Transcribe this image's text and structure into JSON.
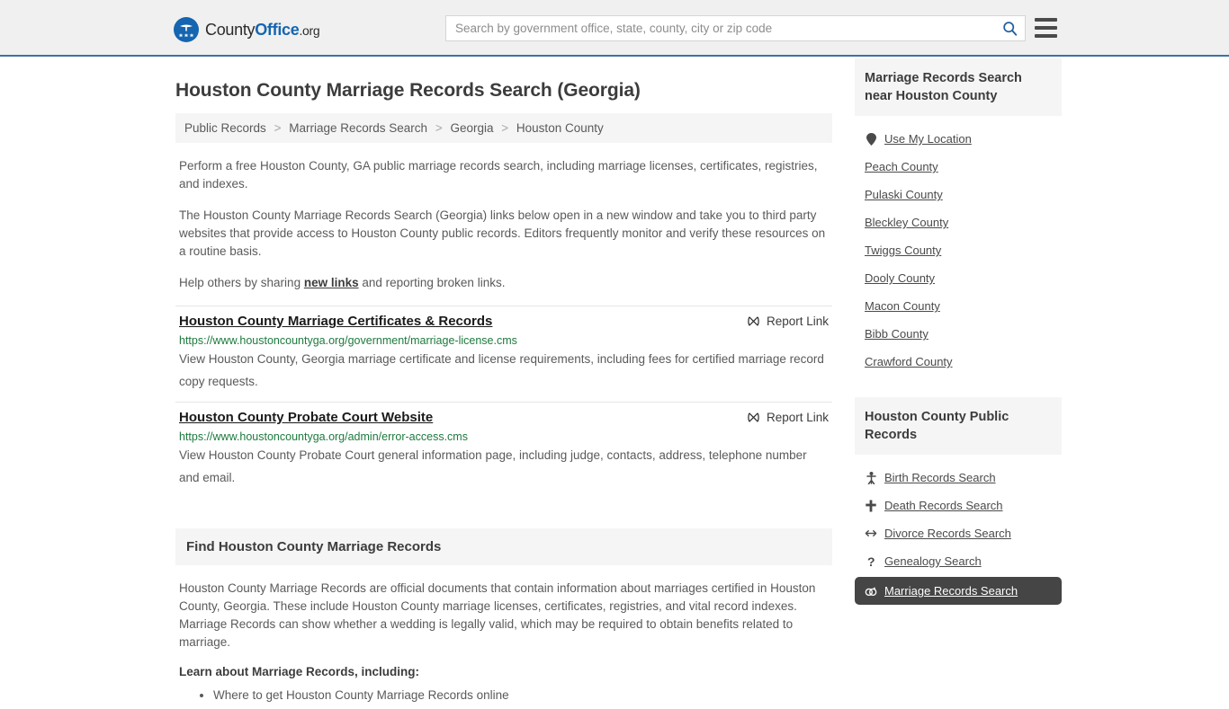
{
  "header": {
    "logo": {
      "part1": "County",
      "part2": "Office",
      "part3": ".org",
      "icon": "eagle-shield-logo"
    },
    "search": {
      "placeholder": "Search by government office, state, county, city or zip code",
      "value": "",
      "icon": "search-icon"
    },
    "menu_icon": "hamburger-menu-icon",
    "accent_color": "#3b72a6"
  },
  "page_title": "Houston County Marriage Records Search (Georgia)",
  "breadcrumb": {
    "items": [
      "Public Records",
      "Marriage Records Search",
      "Georgia",
      "Houston County"
    ],
    "separator": ">"
  },
  "intro": {
    "p1": "Perform a free Houston County, GA public marriage records search, including marriage licenses, certificates, registries, and indexes.",
    "p2": "The Houston County Marriage Records Search (Georgia) links below open in a new window and take you to third party websites that provide access to Houston County public records. Editors frequently monitor and verify these resources on a routine basis.",
    "p3_before": "Help others by sharing ",
    "p3_link": "new links",
    "p3_after": " and reporting broken links."
  },
  "results": [
    {
      "title": "Houston County Marriage Certificates & Records",
      "url": "https://www.houstoncountyga.org/government/marriage-license.cms",
      "description": "View Houston County, Georgia marriage certificate and license requirements, including fees for certified marriage record copy requests.",
      "report_label": "Report Link",
      "report_icon": "broken-link-icon"
    },
    {
      "title": "Houston County Probate Court Website",
      "url": "https://www.houstoncountyga.org/admin/error-access.cms",
      "description": "View Houston County Probate Court general information page, including judge, contacts, address, telephone number and email.",
      "report_label": "Report Link",
      "report_icon": "broken-link-icon"
    }
  ],
  "find_section": {
    "heading": "Find Houston County Marriage Records",
    "paragraph": "Houston County Marriage Records are official documents that contain information about marriages certified in Houston County, Georgia. These include Houston County marriage licenses, certificates, registries, and vital record indexes. Marriage Records can show whether a wedding is legally valid, which may be required to obtain benefits related to marriage.",
    "learn_heading": "Learn about Marriage Records, including:",
    "bullets": [
      "Where to get Houston County Marriage Records online"
    ]
  },
  "sidebar": {
    "nearby": {
      "heading": "Marriage Records Search near Houston County",
      "items": [
        {
          "label": "Use My Location",
          "icon": "map-pin-icon"
        },
        {
          "label": "Peach County",
          "icon": ""
        },
        {
          "label": "Pulaski County",
          "icon": ""
        },
        {
          "label": "Bleckley County",
          "icon": ""
        },
        {
          "label": "Twiggs County",
          "icon": ""
        },
        {
          "label": "Dooly County",
          "icon": ""
        },
        {
          "label": "Macon County",
          "icon": ""
        },
        {
          "label": "Bibb County",
          "icon": ""
        },
        {
          "label": "Crawford County",
          "icon": ""
        }
      ]
    },
    "public_records": {
      "heading": "Houston County Public Records",
      "items": [
        {
          "label": "Birth Records Search",
          "icon": "baby-icon",
          "active": false
        },
        {
          "label": "Death Records Search",
          "icon": "cross-icon",
          "active": false
        },
        {
          "label": "Divorce Records Search",
          "icon": "double-arrow-icon",
          "active": false
        },
        {
          "label": "Genealogy Search",
          "icon": "question-mark-icon",
          "active": false
        },
        {
          "label": "Marriage Records Search",
          "icon": "wedding-rings-icon",
          "active": true
        }
      ],
      "active_bg": "#454545"
    }
  }
}
